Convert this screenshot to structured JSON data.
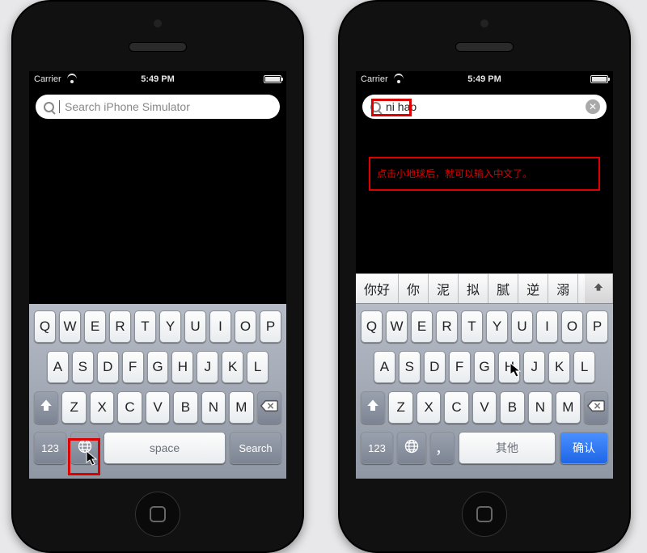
{
  "statusbar": {
    "carrier": "Carrier",
    "time": "5:49 PM"
  },
  "left": {
    "search_placeholder": "Search iPhone Simulator",
    "keyboard": {
      "row1": [
        "Q",
        "W",
        "E",
        "R",
        "T",
        "Y",
        "U",
        "I",
        "O",
        "P"
      ],
      "row2": [
        "A",
        "S",
        "D",
        "F",
        "G",
        "H",
        "J",
        "K",
        "L"
      ],
      "row3": [
        "Z",
        "X",
        "C",
        "V",
        "B",
        "N",
        "M"
      ],
      "k123": "123",
      "space": "space",
      "search": "Search"
    }
  },
  "right": {
    "search_value": "ni hao",
    "annotation": "点击小地球后，就可以输入中文了。",
    "candidates": [
      "你好",
      "你",
      "泥",
      "拟",
      "腻",
      "逆",
      "溺"
    ],
    "keyboard": {
      "row1": [
        "Q",
        "W",
        "E",
        "R",
        "T",
        "Y",
        "U",
        "I",
        "O",
        "P"
      ],
      "row2": [
        "A",
        "S",
        "D",
        "F",
        "G",
        "H",
        "J",
        "K",
        "L"
      ],
      "row3": [
        "Z",
        "X",
        "C",
        "V",
        "B",
        "N",
        "M"
      ],
      "k123": "123",
      "comma": "，",
      "other": "其他",
      "confirm": "确认"
    }
  }
}
